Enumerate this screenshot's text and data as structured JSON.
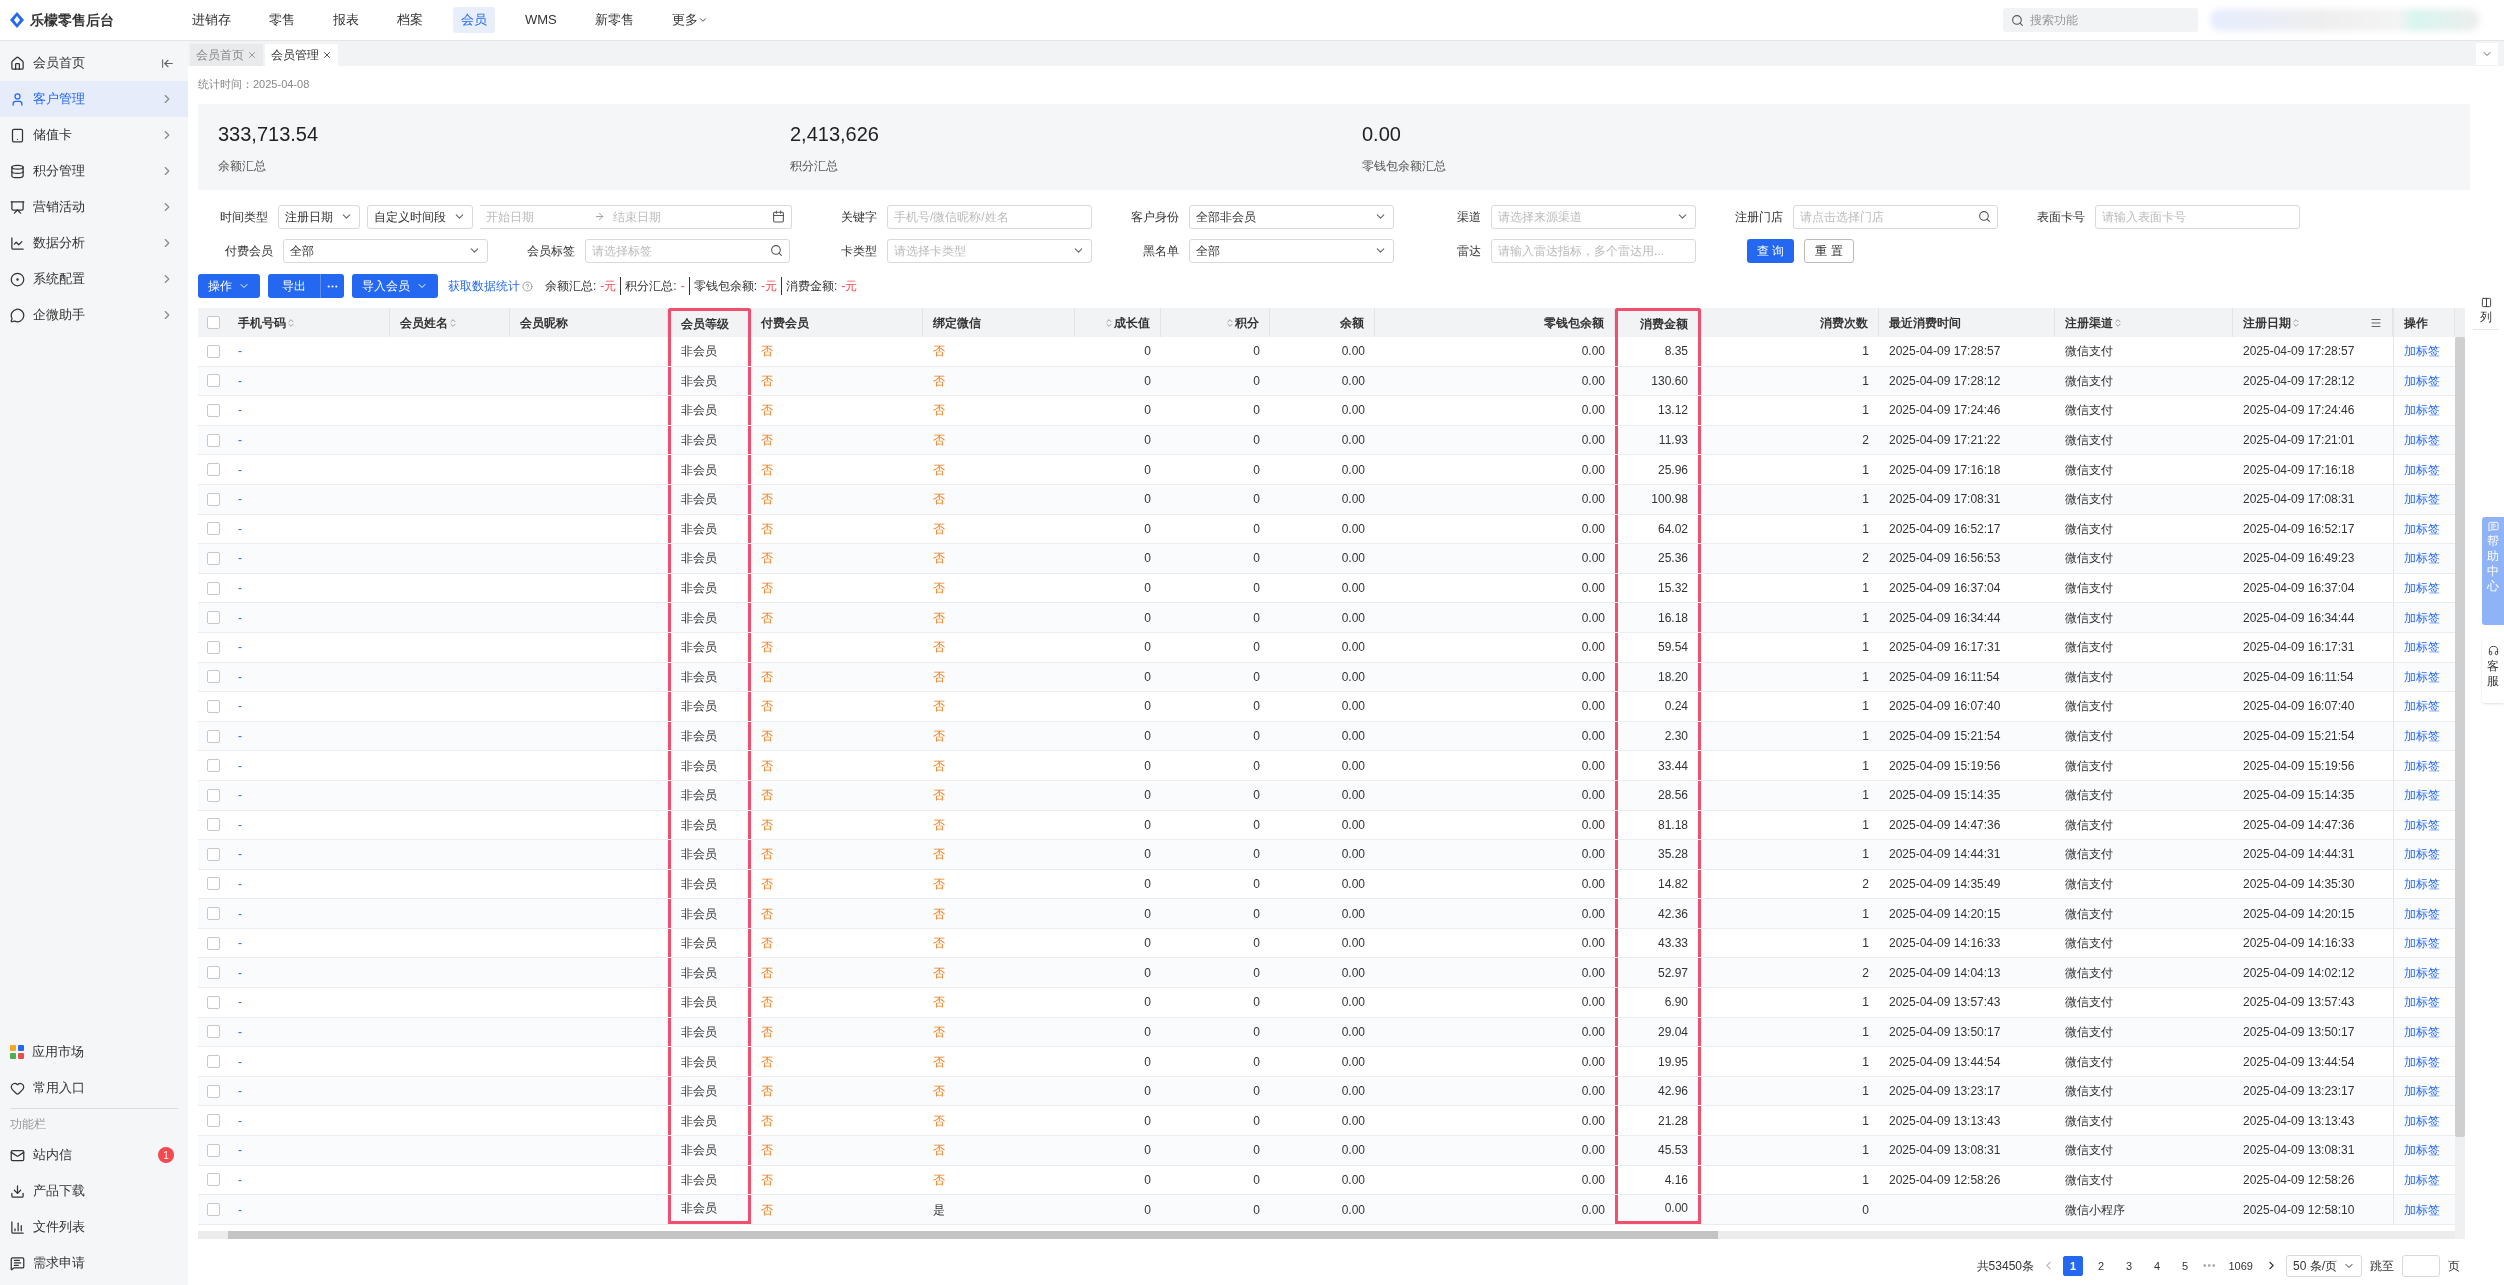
{
  "app": {
    "title": "乐檬零售后台"
  },
  "top_menu": [
    {
      "label": "进销存",
      "selected": false
    },
    {
      "label": "零售",
      "selected": false
    },
    {
      "label": "报表",
      "selected": false
    },
    {
      "label": "档案",
      "selected": false
    },
    {
      "label": "会员",
      "selected": true
    },
    {
      "label": "WMS",
      "selected": false
    },
    {
      "label": "新零售",
      "selected": false
    },
    {
      "label": "更多",
      "selected": false,
      "dropdown": true
    }
  ],
  "top_search": {
    "placeholder": "搜索功能"
  },
  "sidebar": {
    "items": [
      {
        "label": "会员首页",
        "selected": false,
        "expandable": false
      },
      {
        "label": "客户管理",
        "selected": true,
        "expandable": true
      },
      {
        "label": "储值卡",
        "selected": false,
        "expandable": true
      },
      {
        "label": "积分管理",
        "selected": false,
        "expandable": true
      },
      {
        "label": "营销活动",
        "selected": false,
        "expandable": true
      },
      {
        "label": "数据分析",
        "selected": false,
        "expandable": true
      },
      {
        "label": "系统配置",
        "selected": false,
        "expandable": true
      },
      {
        "label": "企微助手",
        "selected": false,
        "expandable": true
      }
    ],
    "bottom_items": [
      {
        "label": "应用市场"
      },
      {
        "label": "常用入口"
      }
    ],
    "section_title": "功能栏",
    "tools": [
      {
        "label": "站内信",
        "badge": "1"
      },
      {
        "label": "产品下载"
      },
      {
        "label": "文件列表"
      },
      {
        "label": "需求申请"
      }
    ]
  },
  "page_tabs": [
    {
      "label": "会员首页",
      "selected": false
    },
    {
      "label": "会员管理",
      "selected": true
    }
  ],
  "stats_time": "统计时间：2025-04-08",
  "stats": [
    {
      "value": "333,713.54",
      "label": "余额汇总"
    },
    {
      "value": "2,413,626",
      "label": "积分汇总"
    },
    {
      "value": "0.00",
      "label": "零钱包余额汇总"
    }
  ],
  "filters": [
    {
      "label": "时间类型",
      "wide": true,
      "controls": [
        {
          "kind": "select",
          "value": "注册日期"
        },
        {
          "kind": "select",
          "value": "自定义时间段"
        },
        {
          "kind": "daterange",
          "start_placeholder": "开始日期",
          "end_placeholder": "结束日期"
        }
      ]
    },
    {
      "label": "关键字",
      "controls": [
        {
          "kind": "input",
          "placeholder": "手机号/微信昵称/姓名"
        }
      ]
    },
    {
      "label": "客户身份",
      "controls": [
        {
          "kind": "select",
          "value": "全部非会员"
        }
      ]
    },
    {
      "label": "渠道",
      "controls": [
        {
          "kind": "select",
          "placeholder": "请选择来源渠道"
        }
      ]
    },
    {
      "label": "注册门店",
      "controls": [
        {
          "kind": "search",
          "placeholder": "请点击选择门店"
        }
      ]
    },
    {
      "label": "表面卡号",
      "controls": [
        {
          "kind": "input",
          "placeholder": "请输入表面卡号"
        }
      ]
    },
    {
      "label": "付费会员",
      "controls": [
        {
          "kind": "select",
          "value": "全部"
        }
      ]
    },
    {
      "label": "会员标签",
      "controls": [
        {
          "kind": "search",
          "placeholder": "请选择标签"
        }
      ]
    },
    {
      "label": "卡类型",
      "controls": [
        {
          "kind": "select",
          "placeholder": "请选择卡类型"
        }
      ]
    },
    {
      "label": "黑名单",
      "controls": [
        {
          "kind": "select",
          "value": "全部"
        }
      ]
    },
    {
      "label": "雷达",
      "controls": [
        {
          "kind": "input",
          "placeholder": "请输入雷达指标，多个雷达用..."
        }
      ]
    }
  ],
  "filter_buttons": [
    {
      "label": "查 询",
      "kind": "primary"
    },
    {
      "label": "重 置",
      "kind": "default"
    }
  ],
  "toolbar": {
    "buttons": [
      {
        "label": "操作",
        "kind": "dropdown"
      },
      {
        "label": "导出",
        "kind": "split"
      },
      {
        "label": "导入会员",
        "kind": "dropdown"
      }
    ],
    "link": "获取数据统计",
    "summary": [
      {
        "label": "余额汇总:",
        "value": "-元"
      },
      {
        "label": "积分汇总:",
        "value": "-"
      },
      {
        "label": "零钱包余额:",
        "value": "-元"
      },
      {
        "label": "消费金额:",
        "value": "-元"
      }
    ]
  },
  "table": {
    "all_checked": false,
    "columns": [
      {
        "label": "手机号码",
        "kind": "link",
        "sortable": true
      },
      {
        "label": "会员姓名",
        "kind": "text",
        "sortable": true
      },
      {
        "label": "会员昵称",
        "kind": "text",
        "sortable": false
      },
      {
        "label": "会员等级",
        "kind": "text",
        "sortable": false,
        "highlighted": true
      },
      {
        "label": "付费会员",
        "kind": "flag",
        "sortable": false
      },
      {
        "label": "绑定微信",
        "kind": "flag",
        "sortable": false
      },
      {
        "label": "成长值",
        "kind": "number",
        "sortable": true
      },
      {
        "label": "积分",
        "kind": "number",
        "sortable": true
      },
      {
        "label": "余额",
        "kind": "number",
        "sortable": false
      },
      {
        "label": "零钱包余额",
        "kind": "number",
        "sortable": false
      },
      {
        "label": "消费金额",
        "kind": "number",
        "sortable": false,
        "highlighted": true
      },
      {
        "label": "消费次数",
        "kind": "number",
        "sortable": false
      },
      {
        "label": "最近消费时间",
        "kind": "text",
        "sortable": false
      },
      {
        "label": "注册渠道",
        "kind": "text",
        "sortable": true
      },
      {
        "label": "注册日期",
        "kind": "text",
        "sortable": true,
        "menu": true
      },
      {
        "label": "操作",
        "kind": "link",
        "sortable": false
      }
    ],
    "rows": [
      {
        "checked": false,
        "cells": [
          "-",
          null,
          null,
          "非会员",
          {
            "text": "否",
            "yes": false
          },
          {
            "text": "否",
            "yes": false
          },
          "0",
          "0",
          "0.00",
          "0.00",
          "8.35",
          "1",
          "2025-04-09 17:28:57",
          "微信支付",
          "2025-04-09 17:28:57",
          "加标签"
        ]
      },
      {
        "checked": false,
        "cells": [
          "-",
          null,
          null,
          "非会员",
          {
            "text": "否",
            "yes": false
          },
          {
            "text": "否",
            "yes": false
          },
          "0",
          "0",
          "0.00",
          "0.00",
          "130.60",
          "1",
          "2025-04-09 17:28:12",
          "微信支付",
          "2025-04-09 17:28:12",
          "加标签"
        ]
      },
      {
        "checked": false,
        "cells": [
          "-",
          null,
          null,
          "非会员",
          {
            "text": "否",
            "yes": false
          },
          {
            "text": "否",
            "yes": false
          },
          "0",
          "0",
          "0.00",
          "0.00",
          "13.12",
          "1",
          "2025-04-09 17:24:46",
          "微信支付",
          "2025-04-09 17:24:46",
          "加标签"
        ]
      },
      {
        "checked": false,
        "cells": [
          "-",
          null,
          null,
          "非会员",
          {
            "text": "否",
            "yes": false
          },
          {
            "text": "否",
            "yes": false
          },
          "0",
          "0",
          "0.00",
          "0.00",
          "11.93",
          "2",
          "2025-04-09 17:21:22",
          "微信支付",
          "2025-04-09 17:21:01",
          "加标签"
        ]
      },
      {
        "checked": false,
        "cells": [
          "-",
          null,
          null,
          "非会员",
          {
            "text": "否",
            "yes": false
          },
          {
            "text": "否",
            "yes": false
          },
          "0",
          "0",
          "0.00",
          "0.00",
          "25.96",
          "1",
          "2025-04-09 17:16:18",
          "微信支付",
          "2025-04-09 17:16:18",
          "加标签"
        ]
      },
      {
        "checked": false,
        "cells": [
          "-",
          null,
          null,
          "非会员",
          {
            "text": "否",
            "yes": false
          },
          {
            "text": "否",
            "yes": false
          },
          "0",
          "0",
          "0.00",
          "0.00",
          "100.98",
          "1",
          "2025-04-09 17:08:31",
          "微信支付",
          "2025-04-09 17:08:31",
          "加标签"
        ]
      },
      {
        "checked": false,
        "cells": [
          "-",
          null,
          null,
          "非会员",
          {
            "text": "否",
            "yes": false
          },
          {
            "text": "否",
            "yes": false
          },
          "0",
          "0",
          "0.00",
          "0.00",
          "64.02",
          "1",
          "2025-04-09 16:52:17",
          "微信支付",
          "2025-04-09 16:52:17",
          "加标签"
        ]
      },
      {
        "checked": false,
        "cells": [
          "-",
          null,
          null,
          "非会员",
          {
            "text": "否",
            "yes": false
          },
          {
            "text": "否",
            "yes": false
          },
          "0",
          "0",
          "0.00",
          "0.00",
          "25.36",
          "2",
          "2025-04-09 16:56:53",
          "微信支付",
          "2025-04-09 16:49:23",
          "加标签"
        ]
      },
      {
        "checked": false,
        "cells": [
          "-",
          null,
          null,
          "非会员",
          {
            "text": "否",
            "yes": false
          },
          {
            "text": "否",
            "yes": false
          },
          "0",
          "0",
          "0.00",
          "0.00",
          "15.32",
          "1",
          "2025-04-09 16:37:04",
          "微信支付",
          "2025-04-09 16:37:04",
          "加标签"
        ]
      },
      {
        "checked": false,
        "cells": [
          "-",
          null,
          null,
          "非会员",
          {
            "text": "否",
            "yes": false
          },
          {
            "text": "否",
            "yes": false
          },
          "0",
          "0",
          "0.00",
          "0.00",
          "16.18",
          "1",
          "2025-04-09 16:34:44",
          "微信支付",
          "2025-04-09 16:34:44",
          "加标签"
        ]
      },
      {
        "checked": false,
        "cells": [
          "-",
          null,
          null,
          "非会员",
          {
            "text": "否",
            "yes": false
          },
          {
            "text": "否",
            "yes": false
          },
          "0",
          "0",
          "0.00",
          "0.00",
          "59.54",
          "1",
          "2025-04-09 16:17:31",
          "微信支付",
          "2025-04-09 16:17:31",
          "加标签"
        ]
      },
      {
        "checked": false,
        "cells": [
          "-",
          null,
          null,
          "非会员",
          {
            "text": "否",
            "yes": false
          },
          {
            "text": "否",
            "yes": false
          },
          "0",
          "0",
          "0.00",
          "0.00",
          "18.20",
          "1",
          "2025-04-09 16:11:54",
          "微信支付",
          "2025-04-09 16:11:54",
          "加标签"
        ]
      },
      {
        "checked": false,
        "cells": [
          "-",
          null,
          null,
          "非会员",
          {
            "text": "否",
            "yes": false
          },
          {
            "text": "否",
            "yes": false
          },
          "0",
          "0",
          "0.00",
          "0.00",
          "0.24",
          "1",
          "2025-04-09 16:07:40",
          "微信支付",
          "2025-04-09 16:07:40",
          "加标签"
        ]
      },
      {
        "checked": false,
        "cells": [
          "-",
          null,
          null,
          "非会员",
          {
            "text": "否",
            "yes": false
          },
          {
            "text": "否",
            "yes": false
          },
          "0",
          "0",
          "0.00",
          "0.00",
          "2.30",
          "1",
          "2025-04-09 15:21:54",
          "微信支付",
          "2025-04-09 15:21:54",
          "加标签"
        ]
      },
      {
        "checked": false,
        "cells": [
          "-",
          null,
          null,
          "非会员",
          {
            "text": "否",
            "yes": false
          },
          {
            "text": "否",
            "yes": false
          },
          "0",
          "0",
          "0.00",
          "0.00",
          "33.44",
          "1",
          "2025-04-09 15:19:56",
          "微信支付",
          "2025-04-09 15:19:56",
          "加标签"
        ]
      },
      {
        "checked": false,
        "cells": [
          "-",
          null,
          null,
          "非会员",
          {
            "text": "否",
            "yes": false
          },
          {
            "text": "否",
            "yes": false
          },
          "0",
          "0",
          "0.00",
          "0.00",
          "28.56",
          "1",
          "2025-04-09 15:14:35",
          "微信支付",
          "2025-04-09 15:14:35",
          "加标签"
        ]
      },
      {
        "checked": false,
        "cells": [
          "-",
          null,
          null,
          "非会员",
          {
            "text": "否",
            "yes": false
          },
          {
            "text": "否",
            "yes": false
          },
          "0",
          "0",
          "0.00",
          "0.00",
          "81.18",
          "1",
          "2025-04-09 14:47:36",
          "微信支付",
          "2025-04-09 14:47:36",
          "加标签"
        ]
      },
      {
        "checked": false,
        "cells": [
          "-",
          null,
          null,
          "非会员",
          {
            "text": "否",
            "yes": false
          },
          {
            "text": "否",
            "yes": false
          },
          "0",
          "0",
          "0.00",
          "0.00",
          "35.28",
          "1",
          "2025-04-09 14:44:31",
          "微信支付",
          "2025-04-09 14:44:31",
          "加标签"
        ]
      },
      {
        "checked": false,
        "cells": [
          "-",
          null,
          null,
          "非会员",
          {
            "text": "否",
            "yes": false
          },
          {
            "text": "否",
            "yes": false
          },
          "0",
          "0",
          "0.00",
          "0.00",
          "14.82",
          "2",
          "2025-04-09 14:35:49",
          "微信支付",
          "2025-04-09 14:35:30",
          "加标签"
        ]
      },
      {
        "checked": false,
        "cells": [
          "-",
          null,
          null,
          "非会员",
          {
            "text": "否",
            "yes": false
          },
          {
            "text": "否",
            "yes": false
          },
          "0",
          "0",
          "0.00",
          "0.00",
          "42.36",
          "1",
          "2025-04-09 14:20:15",
          "微信支付",
          "2025-04-09 14:20:15",
          "加标签"
        ]
      },
      {
        "checked": false,
        "cells": [
          "-",
          null,
          null,
          "非会员",
          {
            "text": "否",
            "yes": false
          },
          {
            "text": "否",
            "yes": false
          },
          "0",
          "0",
          "0.00",
          "0.00",
          "43.33",
          "1",
          "2025-04-09 14:16:33",
          "微信支付",
          "2025-04-09 14:16:33",
          "加标签"
        ]
      },
      {
        "checked": false,
        "cells": [
          "-",
          null,
          null,
          "非会员",
          {
            "text": "否",
            "yes": false
          },
          {
            "text": "否",
            "yes": false
          },
          "0",
          "0",
          "0.00",
          "0.00",
          "52.97",
          "2",
          "2025-04-09 14:04:13",
          "微信支付",
          "2025-04-09 14:02:12",
          "加标签"
        ]
      },
      {
        "checked": false,
        "cells": [
          "-",
          null,
          null,
          "非会员",
          {
            "text": "否",
            "yes": false
          },
          {
            "text": "否",
            "yes": false
          },
          "0",
          "0",
          "0.00",
          "0.00",
          "6.90",
          "1",
          "2025-04-09 13:57:43",
          "微信支付",
          "2025-04-09 13:57:43",
          "加标签"
        ]
      },
      {
        "checked": false,
        "cells": [
          "-",
          null,
          null,
          "非会员",
          {
            "text": "否",
            "yes": false
          },
          {
            "text": "否",
            "yes": false
          },
          "0",
          "0",
          "0.00",
          "0.00",
          "29.04",
          "1",
          "2025-04-09 13:50:17",
          "微信支付",
          "2025-04-09 13:50:17",
          "加标签"
        ]
      },
      {
        "checked": false,
        "cells": [
          "-",
          null,
          null,
          "非会员",
          {
            "text": "否",
            "yes": false
          },
          {
            "text": "否",
            "yes": false
          },
          "0",
          "0",
          "0.00",
          "0.00",
          "19.95",
          "1",
          "2025-04-09 13:44:54",
          "微信支付",
          "2025-04-09 13:44:54",
          "加标签"
        ]
      },
      {
        "checked": false,
        "cells": [
          "-",
          null,
          null,
          "非会员",
          {
            "text": "否",
            "yes": false
          },
          {
            "text": "否",
            "yes": false
          },
          "0",
          "0",
          "0.00",
          "0.00",
          "42.96",
          "1",
          "2025-04-09 13:23:17",
          "微信支付",
          "2025-04-09 13:23:17",
          "加标签"
        ]
      },
      {
        "checked": false,
        "cells": [
          "-",
          null,
          null,
          "非会员",
          {
            "text": "否",
            "yes": false
          },
          {
            "text": "否",
            "yes": false
          },
          "0",
          "0",
          "0.00",
          "0.00",
          "21.28",
          "1",
          "2025-04-09 13:13:43",
          "微信支付",
          "2025-04-09 13:13:43",
          "加标签"
        ]
      },
      {
        "checked": false,
        "cells": [
          "-",
          null,
          null,
          "非会员",
          {
            "text": "否",
            "yes": false
          },
          {
            "text": "否",
            "yes": false
          },
          "0",
          "0",
          "0.00",
          "0.00",
          "45.53",
          "1",
          "2025-04-09 13:08:31",
          "微信支付",
          "2025-04-09 13:08:31",
          "加标签"
        ]
      },
      {
        "checked": false,
        "cells": [
          "-",
          null,
          null,
          "非会员",
          {
            "text": "否",
            "yes": false
          },
          {
            "text": "否",
            "yes": false
          },
          "0",
          "0",
          "0.00",
          "0.00",
          "4.16",
          "1",
          "2025-04-09 12:58:26",
          "微信支付",
          "2025-04-09 12:58:26",
          "加标签"
        ]
      },
      {
        "checked": false,
        "cells": [
          "-",
          null,
          null,
          "非会员",
          {
            "text": "否",
            "yes": false
          },
          {
            "text": "是",
            "yes": true
          },
          "0",
          "0",
          "0.00",
          "0.00",
          "0.00",
          "0",
          null,
          "微信小程序",
          "2025-04-09 12:58:10",
          "加标签"
        ]
      }
    ]
  },
  "pagination": {
    "total": "共53450条",
    "pages": [
      {
        "label": "1",
        "selected": true
      },
      {
        "label": "2",
        "selected": false
      },
      {
        "label": "3",
        "selected": false
      },
      {
        "label": "4",
        "selected": false
      },
      {
        "label": "5",
        "selected": false
      },
      {
        "label": "•••",
        "kind": "ellipsis"
      },
      {
        "label": "1069",
        "selected": false
      }
    ],
    "page_size": "50 条/页",
    "jump_label": "跳至",
    "page_suffix": "页"
  },
  "side_widgets": {
    "columns": "列",
    "help": "帮助中心",
    "service": "客服"
  }
}
